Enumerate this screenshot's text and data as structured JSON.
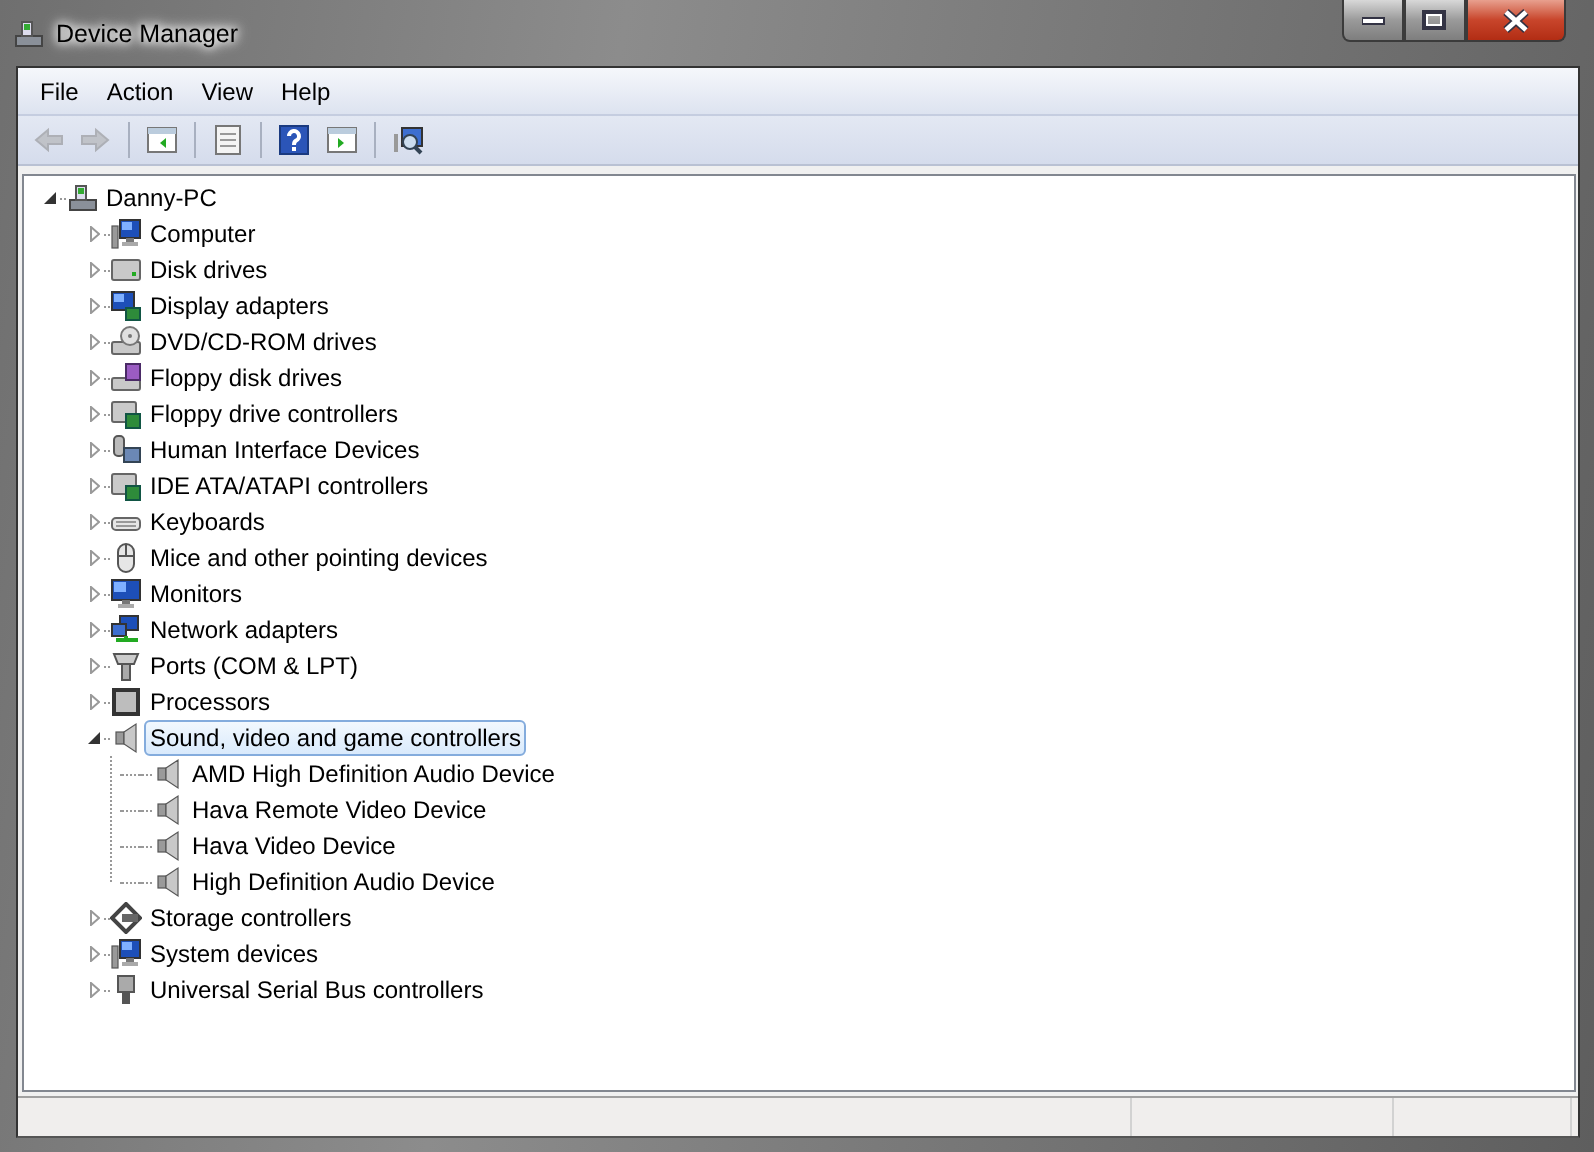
{
  "window": {
    "title": "Device Manager"
  },
  "menu": [
    "File",
    "Action",
    "View",
    "Help"
  ],
  "toolbar": [
    {
      "kind": "back",
      "disabled": true
    },
    {
      "kind": "forward",
      "disabled": true
    },
    {
      "kind": "tree-pane",
      "disabled": false
    },
    {
      "kind": "properties",
      "disabled": false
    },
    {
      "kind": "help",
      "disabled": false
    },
    {
      "kind": "action-pane",
      "disabled": false
    },
    {
      "kind": "scan",
      "disabled": false
    }
  ],
  "tree": [
    {
      "label": "Danny-PC",
      "kind": "pc",
      "expanded": true,
      "selected": false,
      "children": [
        {
          "label": "Computer",
          "kind": "computer",
          "expanded": false,
          "selected": false
        },
        {
          "label": "Disk drives",
          "kind": "disk",
          "expanded": false,
          "selected": false
        },
        {
          "label": "Display adapters",
          "kind": "display",
          "expanded": false,
          "selected": false
        },
        {
          "label": "DVD/CD-ROM drives",
          "kind": "dvd",
          "expanded": false,
          "selected": false
        },
        {
          "label": "Floppy disk drives",
          "kind": "floppy",
          "expanded": false,
          "selected": false
        },
        {
          "label": "Floppy drive controllers",
          "kind": "controller",
          "expanded": false,
          "selected": false
        },
        {
          "label": "Human Interface Devices",
          "kind": "hid",
          "expanded": false,
          "selected": false
        },
        {
          "label": "IDE ATA/ATAPI controllers",
          "kind": "controller",
          "expanded": false,
          "selected": false
        },
        {
          "label": "Keyboards",
          "kind": "keyboard",
          "expanded": false,
          "selected": false
        },
        {
          "label": "Mice and other pointing devices",
          "kind": "mouse",
          "expanded": false,
          "selected": false
        },
        {
          "label": "Monitors",
          "kind": "monitor",
          "expanded": false,
          "selected": false
        },
        {
          "label": "Network adapters",
          "kind": "network",
          "expanded": false,
          "selected": false
        },
        {
          "label": "Ports (COM & LPT)",
          "kind": "port",
          "expanded": false,
          "selected": false
        },
        {
          "label": "Processors",
          "kind": "cpu",
          "expanded": false,
          "selected": false
        },
        {
          "label": "Sound, video and game controllers",
          "kind": "speaker",
          "expanded": true,
          "selected": true,
          "children": [
            {
              "label": "AMD High Definition Audio Device",
              "kind": "speaker",
              "selected": false
            },
            {
              "label": "Hava Remote Video Device",
              "kind": "speaker",
              "selected": false
            },
            {
              "label": "Hava Video Device",
              "kind": "speaker",
              "selected": false
            },
            {
              "label": "High Definition Audio Device",
              "kind": "speaker",
              "selected": false
            }
          ]
        },
        {
          "label": "Storage controllers",
          "kind": "storage",
          "expanded": false,
          "selected": false
        },
        {
          "label": "System devices",
          "kind": "computer",
          "expanded": false,
          "selected": false
        },
        {
          "label": "Universal Serial Bus controllers",
          "kind": "usb",
          "expanded": false,
          "selected": false
        }
      ]
    }
  ]
}
